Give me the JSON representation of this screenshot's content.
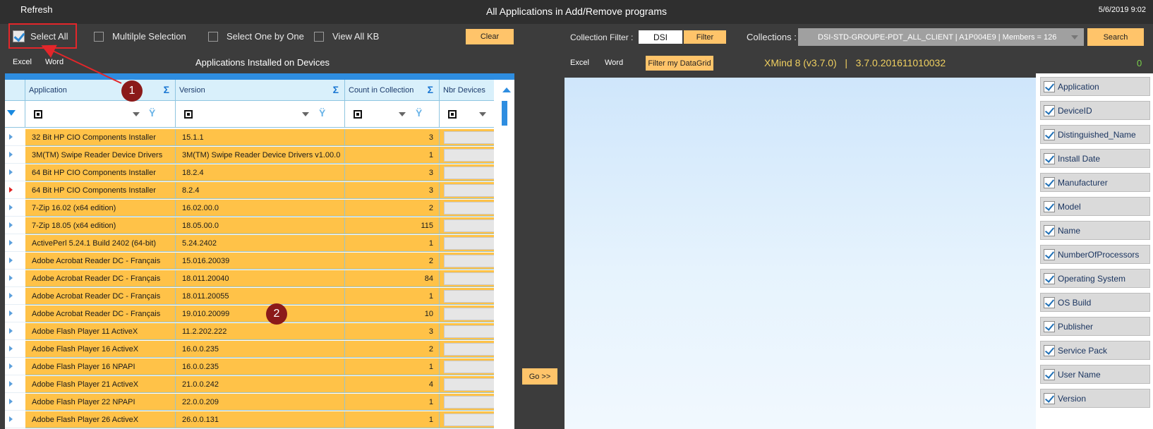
{
  "header": {
    "refresh_label": "Refresh",
    "title": "All Applications in Add/Remove programs",
    "datetime": "5/6/2019 9:02"
  },
  "options": {
    "select_all": "Select All",
    "multiple_selection": "Multilple Selection",
    "select_one_by_one": "Select One by One",
    "view_all_kb": "View All KB",
    "clear": "Clear"
  },
  "left_toolbar": {
    "excel": "Excel",
    "word": "Word",
    "section_title": "Applications Installed on Devices"
  },
  "collection": {
    "filter_label": "Collection Filter :",
    "filter_value": "DSI",
    "filter_button": "Filter",
    "collections_label": "Collections :",
    "collections_value": "DSI-STD-GROUPE-PDT_ALL_CLIENT  |  A1P004E9  |  Members = 126",
    "search_button": "Search"
  },
  "right_toolbar": {
    "excel": "Excel",
    "word": "Word",
    "filter_grid": "Filter my DataGrid",
    "selected_app": "XMind 8 (v3.7.0)   |   3.7.0.201611010032",
    "count": "0"
  },
  "grid": {
    "columns": [
      "Application",
      "Version",
      "Count in Collection",
      "Nbr Devices"
    ],
    "rows": [
      {
        "app": "32 Bit HP CIO Components Installer",
        "version": "15.1.1",
        "count": "3"
      },
      {
        "app": "3M(TM) Swipe Reader Device Drivers",
        "version": "3M(TM) Swipe Reader Device Drivers v1.00.0",
        "count": "1"
      },
      {
        "app": "64 Bit HP CIO Components Installer",
        "version": "18.2.4",
        "count": "3"
      },
      {
        "app": "64 Bit HP CIO Components Installer",
        "version": "8.2.4",
        "count": "3"
      },
      {
        "app": "7-Zip 16.02 (x64 edition)",
        "version": "16.02.00.0",
        "count": "2"
      },
      {
        "app": "7-Zip 18.05 (x64 edition)",
        "version": "18.05.00.0",
        "count": "115"
      },
      {
        "app": "ActivePerl 5.24.1 Build 2402 (64-bit)",
        "version": "5.24.2402",
        "count": "1"
      },
      {
        "app": "Adobe Acrobat Reader DC - Français",
        "version": "15.016.20039",
        "count": "2"
      },
      {
        "app": "Adobe Acrobat Reader DC - Français",
        "version": "18.011.20040",
        "count": "84"
      },
      {
        "app": "Adobe Acrobat Reader DC - Français",
        "version": "18.011.20055",
        "count": "1"
      },
      {
        "app": "Adobe Acrobat Reader DC - Français",
        "version": "19.010.20099",
        "count": "10"
      },
      {
        "app": "Adobe Flash Player 11 ActiveX",
        "version": "11.2.202.222",
        "count": "3"
      },
      {
        "app": "Adobe Flash Player 16 ActiveX",
        "version": "16.0.0.235",
        "count": "2"
      },
      {
        "app": "Adobe Flash Player 16 NPAPI",
        "version": "16.0.0.235",
        "count": "1"
      },
      {
        "app": "Adobe Flash Player 21 ActiveX",
        "version": "21.0.0.242",
        "count": "4"
      },
      {
        "app": "Adobe Flash Player 22 NPAPI",
        "version": "22.0.0.209",
        "count": "1"
      },
      {
        "app": "Adobe Flash Player 26 ActiveX",
        "version": "26.0.0.131",
        "count": "1"
      }
    ]
  },
  "go_button": "Go  >>",
  "column_list": [
    "Application",
    "DeviceID",
    "Distinguished_Name",
    "Install Date",
    "Manufacturer",
    "Model",
    "Name",
    "NumberOfProcessors",
    "Operating System",
    "OS Build",
    "Publisher",
    "Service Pack",
    "User Name",
    "Version"
  ],
  "annotations": {
    "badge1": "1",
    "badge2": "2"
  },
  "colors": {
    "accent": "#2e8de0",
    "row_fill": "#ffc248",
    "button": "#ffc46a",
    "highlight": "#e3262a",
    "badge": "#8b1a1a"
  }
}
